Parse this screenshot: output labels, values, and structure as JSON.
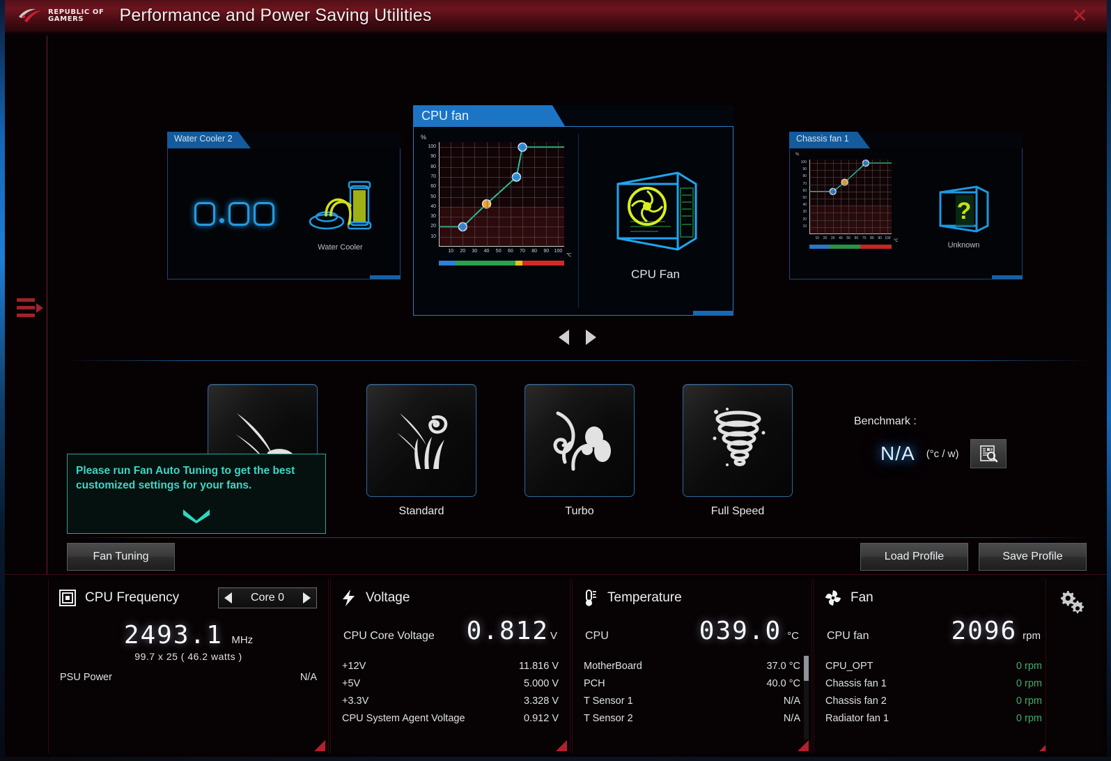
{
  "window": {
    "title": "Performance and Power Saving Utilities",
    "brand_line1": "REPUBLIC OF",
    "brand_line2": "GAMERS",
    "close_icon": "close-icon"
  },
  "sidebar": {
    "menu_icon": "hamburger-menu-icon"
  },
  "carousel": {
    "prev_icon": "chevron-left-icon",
    "next_icon": "chevron-right-icon",
    "cards": [
      {
        "id": "water-cooler-2",
        "title": "Water Cooler 2",
        "position": "left",
        "readout": "0.00",
        "device_label": "Water Cooler",
        "device_icon": "water-cooler-icon"
      },
      {
        "id": "cpu-fan",
        "title": "CPU fan",
        "position": "center",
        "device_label": "CPU Fan",
        "device_icon": "pc-case-fan-icon"
      },
      {
        "id": "chassis-fan-1",
        "title": "Chassis fan 1",
        "position": "right",
        "device_label": "Unknown",
        "device_icon": "unknown-case-icon"
      }
    ]
  },
  "chart_data": [
    {
      "id": "cpu-fan-curve",
      "type": "line",
      "title": "CPU fan",
      "xlabel": "°C",
      "ylabel": "%",
      "xlim": [
        0,
        105
      ],
      "ylim": [
        0,
        105
      ],
      "xticks": [
        10,
        20,
        30,
        40,
        50,
        60,
        70,
        80,
        90,
        100
      ],
      "yticks": [
        10,
        20,
        30,
        40,
        50,
        60,
        70,
        80,
        90,
        100
      ],
      "grid": true,
      "line_color": "#1fc9a0",
      "points": [
        {
          "x": 20,
          "y": 20,
          "color": "#2f8fe0"
        },
        {
          "x": 40,
          "y": 43,
          "color": "#f0a32a"
        },
        {
          "x": 65,
          "y": 70,
          "color": "#2f8fe0"
        },
        {
          "x": 70,
          "y": 100,
          "color": "#2f8fe0"
        }
      ],
      "flat_start_y": 20,
      "flat_end_y": 100,
      "temp_bands": [
        {
          "label": "low",
          "from": 10,
          "to": 22,
          "color": "#2f7fd4"
        },
        {
          "label": "mid",
          "from": 22,
          "to": 65,
          "color": "#2f9e4f"
        },
        {
          "label": "high",
          "from": 65,
          "to": 70,
          "color": "#e3c220"
        },
        {
          "label": "critical",
          "from": 70,
          "to": 100,
          "color": "#d42a27"
        }
      ]
    },
    {
      "id": "chassis-fan-1-curve",
      "type": "line",
      "title": "Chassis fan 1",
      "xlabel": "°C",
      "ylabel": "%",
      "xlim": [
        0,
        105
      ],
      "ylim": [
        0,
        105
      ],
      "xticks": [
        10,
        20,
        30,
        40,
        50,
        60,
        70,
        80,
        90,
        100
      ],
      "yticks": [
        10,
        20,
        30,
        40,
        50,
        60,
        70,
        80,
        90,
        100
      ],
      "grid": true,
      "line_color": "#1fc9a0",
      "points": [
        {
          "x": 30,
          "y": 60,
          "color": "#2f8fe0"
        },
        {
          "x": 45,
          "y": 73,
          "color": "#f0a32a"
        },
        {
          "x": 72,
          "y": 100,
          "color": "#2f8fe0"
        }
      ],
      "flat_start_y": 60,
      "flat_end_y": 100,
      "temp_bands": [
        {
          "label": "low",
          "from": 10,
          "to": 32,
          "color": "#2f7fd4"
        },
        {
          "label": "mid",
          "from": 32,
          "to": 66,
          "color": "#2f9e4f"
        },
        {
          "label": "critical",
          "from": 66,
          "to": 100,
          "color": "#d42a27"
        }
      ]
    }
  ],
  "modes": [
    {
      "id": "silent",
      "label": "",
      "icon": "feather-silent-icon",
      "selected": false
    },
    {
      "id": "standard",
      "label": "Standard",
      "icon": "wind-grass-icon",
      "selected": false
    },
    {
      "id": "turbo",
      "label": "Turbo",
      "icon": "swirl-turbo-icon",
      "selected": false
    },
    {
      "id": "fullspeed",
      "label": "Full Speed",
      "icon": "tornado-icon",
      "selected": false
    }
  ],
  "tooltip": {
    "text": "Please run Fan Auto Tuning to get the best customized settings for your fans.",
    "chevron_icon": "chevron-down-icon"
  },
  "benchmark": {
    "label": "Benchmark :",
    "value": "N/A",
    "unit": "(°c / w)",
    "button_icon": "report-search-icon"
  },
  "actions": {
    "fan_tuning": "Fan Tuning",
    "load_profile": "Load Profile",
    "save_profile": "Save Profile"
  },
  "monitor": {
    "settings_icon": "gears-icon",
    "cpu_frequency": {
      "icon": "cpu-chip-icon",
      "title": "CPU Frequency",
      "core_selector": {
        "value": "Core 0",
        "prev_icon": "arrow-left-icon",
        "next_icon": "arrow-right-icon"
      },
      "value": "2493.1",
      "unit": "MHz",
      "sub": "99.7  x  25      ( 46.2 watts )",
      "rows": [
        {
          "label": "PSU Power",
          "value": "N/A",
          "green": false
        }
      ]
    },
    "voltage": {
      "icon": "lightning-bolt-icon",
      "title": "Voltage",
      "primary_label": "CPU Core Voltage",
      "value": "0.812",
      "unit": "V",
      "rows": [
        {
          "label": "+12V",
          "value": "11.816  V",
          "green": false
        },
        {
          "label": "+5V",
          "value": "5.000  V",
          "green": false
        },
        {
          "label": "+3.3V",
          "value": "3.328  V",
          "green": false
        },
        {
          "label": "CPU System Agent Voltage",
          "value": "0.912  V",
          "green": false
        }
      ]
    },
    "temperature": {
      "icon": "thermometer-icon",
      "title": "Temperature",
      "primary_label": "CPU",
      "value": "039.0",
      "unit": "°C",
      "rows": [
        {
          "label": "MotherBoard",
          "value": "37.0 °C",
          "green": false
        },
        {
          "label": "PCH",
          "value": "40.0 °C",
          "green": false
        },
        {
          "label": "T Sensor 1",
          "value": "N/A",
          "green": false
        },
        {
          "label": "T Sensor 2",
          "value": "N/A",
          "green": false
        }
      ]
    },
    "fan": {
      "icon": "fan-blade-icon",
      "title": "Fan",
      "primary_label": "CPU fan",
      "value": "2096",
      "unit": "rpm",
      "rows": [
        {
          "label": "CPU_OPT",
          "value": "0  rpm",
          "green": true
        },
        {
          "label": "Chassis fan 1",
          "value": "0  rpm",
          "green": true
        },
        {
          "label": "Chassis fan 2",
          "value": "0  rpm",
          "green": true
        },
        {
          "label": "Radiator fan 1",
          "value": "0  rpm",
          "green": true
        }
      ]
    }
  }
}
